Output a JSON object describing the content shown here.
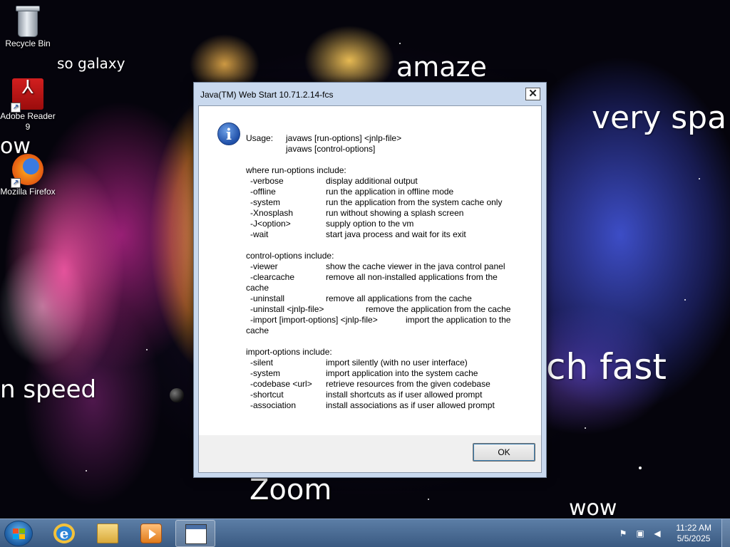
{
  "desktop": {
    "icons": [
      {
        "label": "Recycle Bin"
      },
      {
        "label": "Adobe Reader 9"
      },
      {
        "label": "Mozilla Firefox"
      }
    ],
    "wallpaper_words": [
      "so galaxy",
      "amaze",
      "very spa",
      "ow",
      "n speed",
      "ch fast",
      "Zoom",
      "wow"
    ]
  },
  "dialog": {
    "title": "Java(TM) Web Start 10.71.2.14-fcs",
    "close_glyph": "✕",
    "icon_glyph": "i",
    "usage_label": "Usage:",
    "usage_lines": [
      "javaws [run-options] <jnlp-file>",
      "javaws [control-options]"
    ],
    "run_header": "where run-options include:",
    "run_options": [
      {
        "opt": "-verbose",
        "desc": "display additional output"
      },
      {
        "opt": "-offline",
        "desc": "run the application in offline mode"
      },
      {
        "opt": "-system",
        "desc": "run the application from the system cache only"
      },
      {
        "opt": "-Xnosplash",
        "desc": "run without showing a splash screen"
      },
      {
        "opt": "-J<option>",
        "desc": "supply option to the vm"
      },
      {
        "opt": "-wait",
        "desc": "start java process and wait for its exit"
      }
    ],
    "control_header": "control-options include:",
    "control_options": [
      {
        "opt": "-viewer",
        "desc": "show the cache viewer in the java control panel"
      },
      {
        "opt": "-clearcache",
        "desc": "remove all non-installed applications from the",
        "cont": "cache"
      },
      {
        "opt": "-uninstall",
        "desc": "remove all applications from the cache"
      },
      {
        "opt": "-uninstall <jnlp-file>",
        "desc": "remove the application from the cache"
      },
      {
        "opt": "-import [import-options] <jnlp-file>",
        "desc": "import the application to the",
        "cont": "cache"
      }
    ],
    "import_header": "import-options include:",
    "import_options": [
      {
        "opt": "-silent",
        "desc": "import silently (with no user interface)"
      },
      {
        "opt": "-system",
        "desc": "import application into the system cache"
      },
      {
        "opt": "-codebase <url>",
        "desc": "retrieve resources from the given codebase"
      },
      {
        "opt": "-shortcut",
        "desc": "install shortcuts as if user allowed prompt"
      },
      {
        "opt": "-association",
        "desc": "install associations as if user allowed prompt"
      }
    ],
    "ok_label": "OK"
  },
  "taskbar": {
    "clock_time": "11:22 AM",
    "clock_date": "5/5/2025",
    "apps": [
      "ie-icon",
      "explorer-icon",
      "media-player-icon",
      "java-window-icon"
    ]
  },
  "colors": {
    "taskbar": "#4a6c94",
    "dialog_frame": "#c9d9ee",
    "info_icon": "#1f4fa8"
  }
}
